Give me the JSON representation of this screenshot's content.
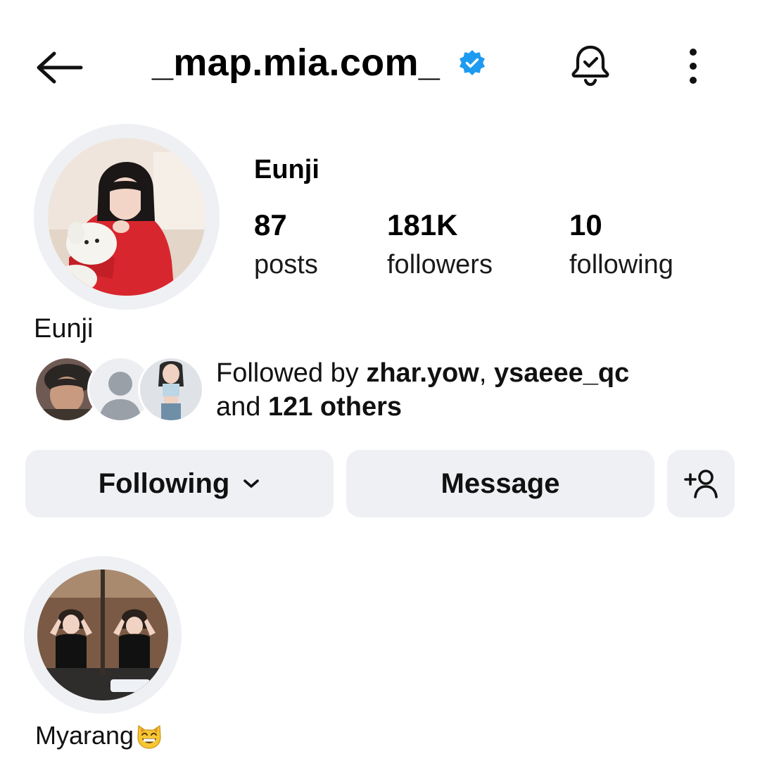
{
  "header": {
    "username": "_map.mia.com_",
    "verified": true
  },
  "profile": {
    "display_name": "Eunji",
    "bio_name": "Eunji",
    "stats": [
      {
        "number": "87",
        "label": "posts"
      },
      {
        "number": "181K",
        "label": "followers"
      },
      {
        "number": "10",
        "label": "following"
      }
    ]
  },
  "followed_by": {
    "prefix": "Followed by ",
    "user1": "zhar.yow",
    "separator": ", ",
    "user2": "ysaeee_qc",
    "and_text": "and ",
    "others": "121 others"
  },
  "buttons": {
    "following": "Following",
    "message": "Message"
  },
  "highlights": [
    {
      "label": "Myarang",
      "emoji": "grinning-cat-emoji"
    }
  ],
  "icons": {
    "back": "arrow-left-icon",
    "verified": "verified-badge-icon",
    "bell": "bell-check-icon",
    "more": "more-vertical-icon",
    "chevron": "chevron-down-icon",
    "add_user": "add-user-icon"
  },
  "colors": {
    "verified_blue": "#1d9bf0",
    "button_bg": "#eff0f3",
    "ring": "#eef0f3"
  }
}
